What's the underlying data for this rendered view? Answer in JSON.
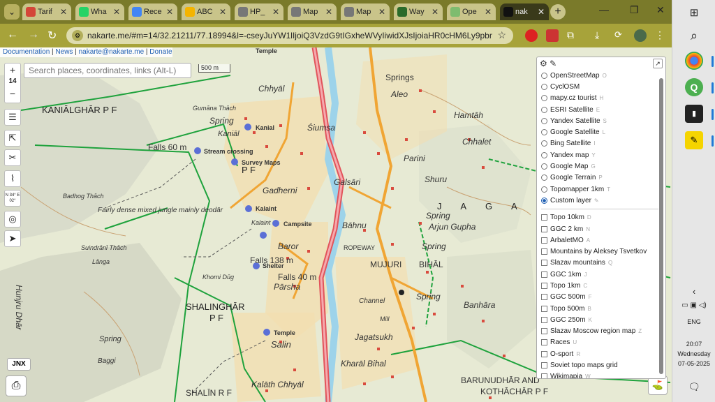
{
  "tabs": [
    {
      "label": "Tarif",
      "fav": "gmail-icon",
      "color": "#d44638"
    },
    {
      "label": "Wha",
      "fav": "whatsapp-icon",
      "color": "#25d366"
    },
    {
      "label": "Rece",
      "fav": "drive-icon",
      "color": "#4285f4"
    },
    {
      "label": "ABC",
      "fav": "slides-icon",
      "color": "#f4b400"
    },
    {
      "label": "HP_",
      "fav": "globe-icon",
      "color": "#777777"
    },
    {
      "label": "Map",
      "fav": "globe-icon",
      "color": "#777777"
    },
    {
      "label": "Map",
      "fav": "globe-icon",
      "color": "#777777"
    },
    {
      "label": "Way",
      "fav": "waymarked-icon",
      "color": "#2a6b2a"
    },
    {
      "label": "Ope",
      "fav": "osm-icon",
      "color": "#7ebc6f"
    },
    {
      "label": "nak",
      "fav": "nakarte-icon",
      "color": "#111111"
    }
  ],
  "address": {
    "url": "nakarte.me/#m=14/32.21211/77.18994&l=-cseyJuYW1lIjoiQ3VzdG9tIGxheWVyIiwidXJsIjoiaHR0cHM6Ly9pbmRpYX..."
  },
  "map": {
    "top_links": [
      "Documentation",
      "News",
      "nakarte@nakarte.me",
      "Donate"
    ],
    "search_placeholder": "Search places, coordinates, links (Alt-L)",
    "scale": "500 m",
    "zoom_level": "14",
    "coords_short": "N 34° E 02°",
    "jnx_label": "JNX",
    "labels": {
      "kanialghar": "KANIĀLGHĀR P F",
      "falls60": "Falls 60 m",
      "stream": "Stream crossing",
      "survey": "Survey Maps",
      "kanial": "Kanial",
      "kanial2": "Kaniāl",
      "chhyal": "Chhyāl",
      "spring1": "Spring",
      "gumana": "Gumāna Thāch",
      "siumsa": "Śiumsa",
      "aleo": "Aleo",
      "springs": "Springs",
      "hamtah": "Hamtāh",
      "chhalet": "Chhalet",
      "parini": "Parini",
      "shuru": "Shuru",
      "galsari": "Galsāri",
      "gadherni": "Gadherni",
      "pf": "P F",
      "kalaint": "Kalaint",
      "kalaint2": "Kalaint",
      "campsite": "Campsite",
      "bahnu": "Bāhnu",
      "fairly": "Fairly dense mixed jungle mainly deodār",
      "badhog": "Badhog Thāch",
      "ropeway": "ROPEWAY",
      "mujuri": "MUJURI",
      "bihal": "BIHĀL",
      "arjun": "Arjun Gupha",
      "spring_r": "Spring",
      "spring_r2": "Spring",
      "baror": "Baror",
      "falls138": "Falls 138 m",
      "shelter": "Shelter",
      "falls40": "Falls 40 m",
      "parsha": "Pārsha",
      "khorni": "Khorni Dūg",
      "suindrani": "Suindrānī Thāch",
      "langa": "Lānga",
      "shalinghar": "SHALINGHĀR",
      "pf2": "P F",
      "hunjru": "Hunjru Dhār",
      "spring_l": "Spring",
      "baggi": "Baggi",
      "temple": "Temple",
      "salin": "Salin",
      "jagatsukh": "Jagatsukh",
      "kharal": "Kharāl Bihal",
      "channel": "Channel",
      "banhara": "Banhāra",
      "mill": "Mill",
      "barunudhar": "BARUNUDHĀR AND",
      "kothachar": "KOTHĀCHĀR P F",
      "shalin": "SHALĪN R F",
      "kalath": "Kalāth Chhyāl",
      "temple_top": "Temple",
      "jaga": "J A G A"
    }
  },
  "layers": {
    "base": [
      {
        "label": "OpenStreetMap",
        "key": "O",
        "on": false
      },
      {
        "label": "CyclOSM",
        "key": "",
        "on": false
      },
      {
        "label": "mapy.cz tourist",
        "key": "H",
        "on": false
      },
      {
        "label": "ESRI Satellite",
        "key": "E",
        "on": false
      },
      {
        "label": "Yandex Satellite",
        "key": "S",
        "on": false
      },
      {
        "label": "Google Satellite",
        "key": "L",
        "on": false
      },
      {
        "label": "Bing Satellite",
        "key": "I",
        "on": false
      },
      {
        "label": "Yandex map",
        "key": "Y",
        "on": false
      },
      {
        "label": "Google Map",
        "key": "G",
        "on": false
      },
      {
        "label": "Google Terrain",
        "key": "P",
        "on": false
      },
      {
        "label": "Topomapper 1km",
        "key": "T",
        "on": false
      },
      {
        "label": "Custom layer",
        "key": "✎",
        "on": true
      }
    ],
    "overlays": [
      {
        "label": "Topo 10km",
        "key": "D"
      },
      {
        "label": "GGC 2 km",
        "key": "N"
      },
      {
        "label": "ArbaletMO",
        "key": "A"
      },
      {
        "label": "Mountains by Aleksey Tsvetkov",
        "key": ""
      },
      {
        "label": "Slazav mountains",
        "key": "Q"
      },
      {
        "label": "GGC 1km",
        "key": "J"
      },
      {
        "label": "Topo 1km",
        "key": "C"
      },
      {
        "label": "GGC 500m",
        "key": "F"
      },
      {
        "label": "Topo 500m",
        "key": "B"
      },
      {
        "label": "GGC 250m",
        "key": "K"
      },
      {
        "label": "Slazav Moscow region map",
        "key": "Z"
      },
      {
        "label": "Races",
        "key": "U"
      },
      {
        "label": "O-sport",
        "key": "R"
      },
      {
        "label": "Soviet topo maps grid",
        "key": ""
      },
      {
        "label": "Wikimapia",
        "key": "W"
      }
    ]
  },
  "taskbar": {
    "lang": "ENG",
    "time": "20:07",
    "day": "Wednesday",
    "date": "07-05-2025"
  }
}
